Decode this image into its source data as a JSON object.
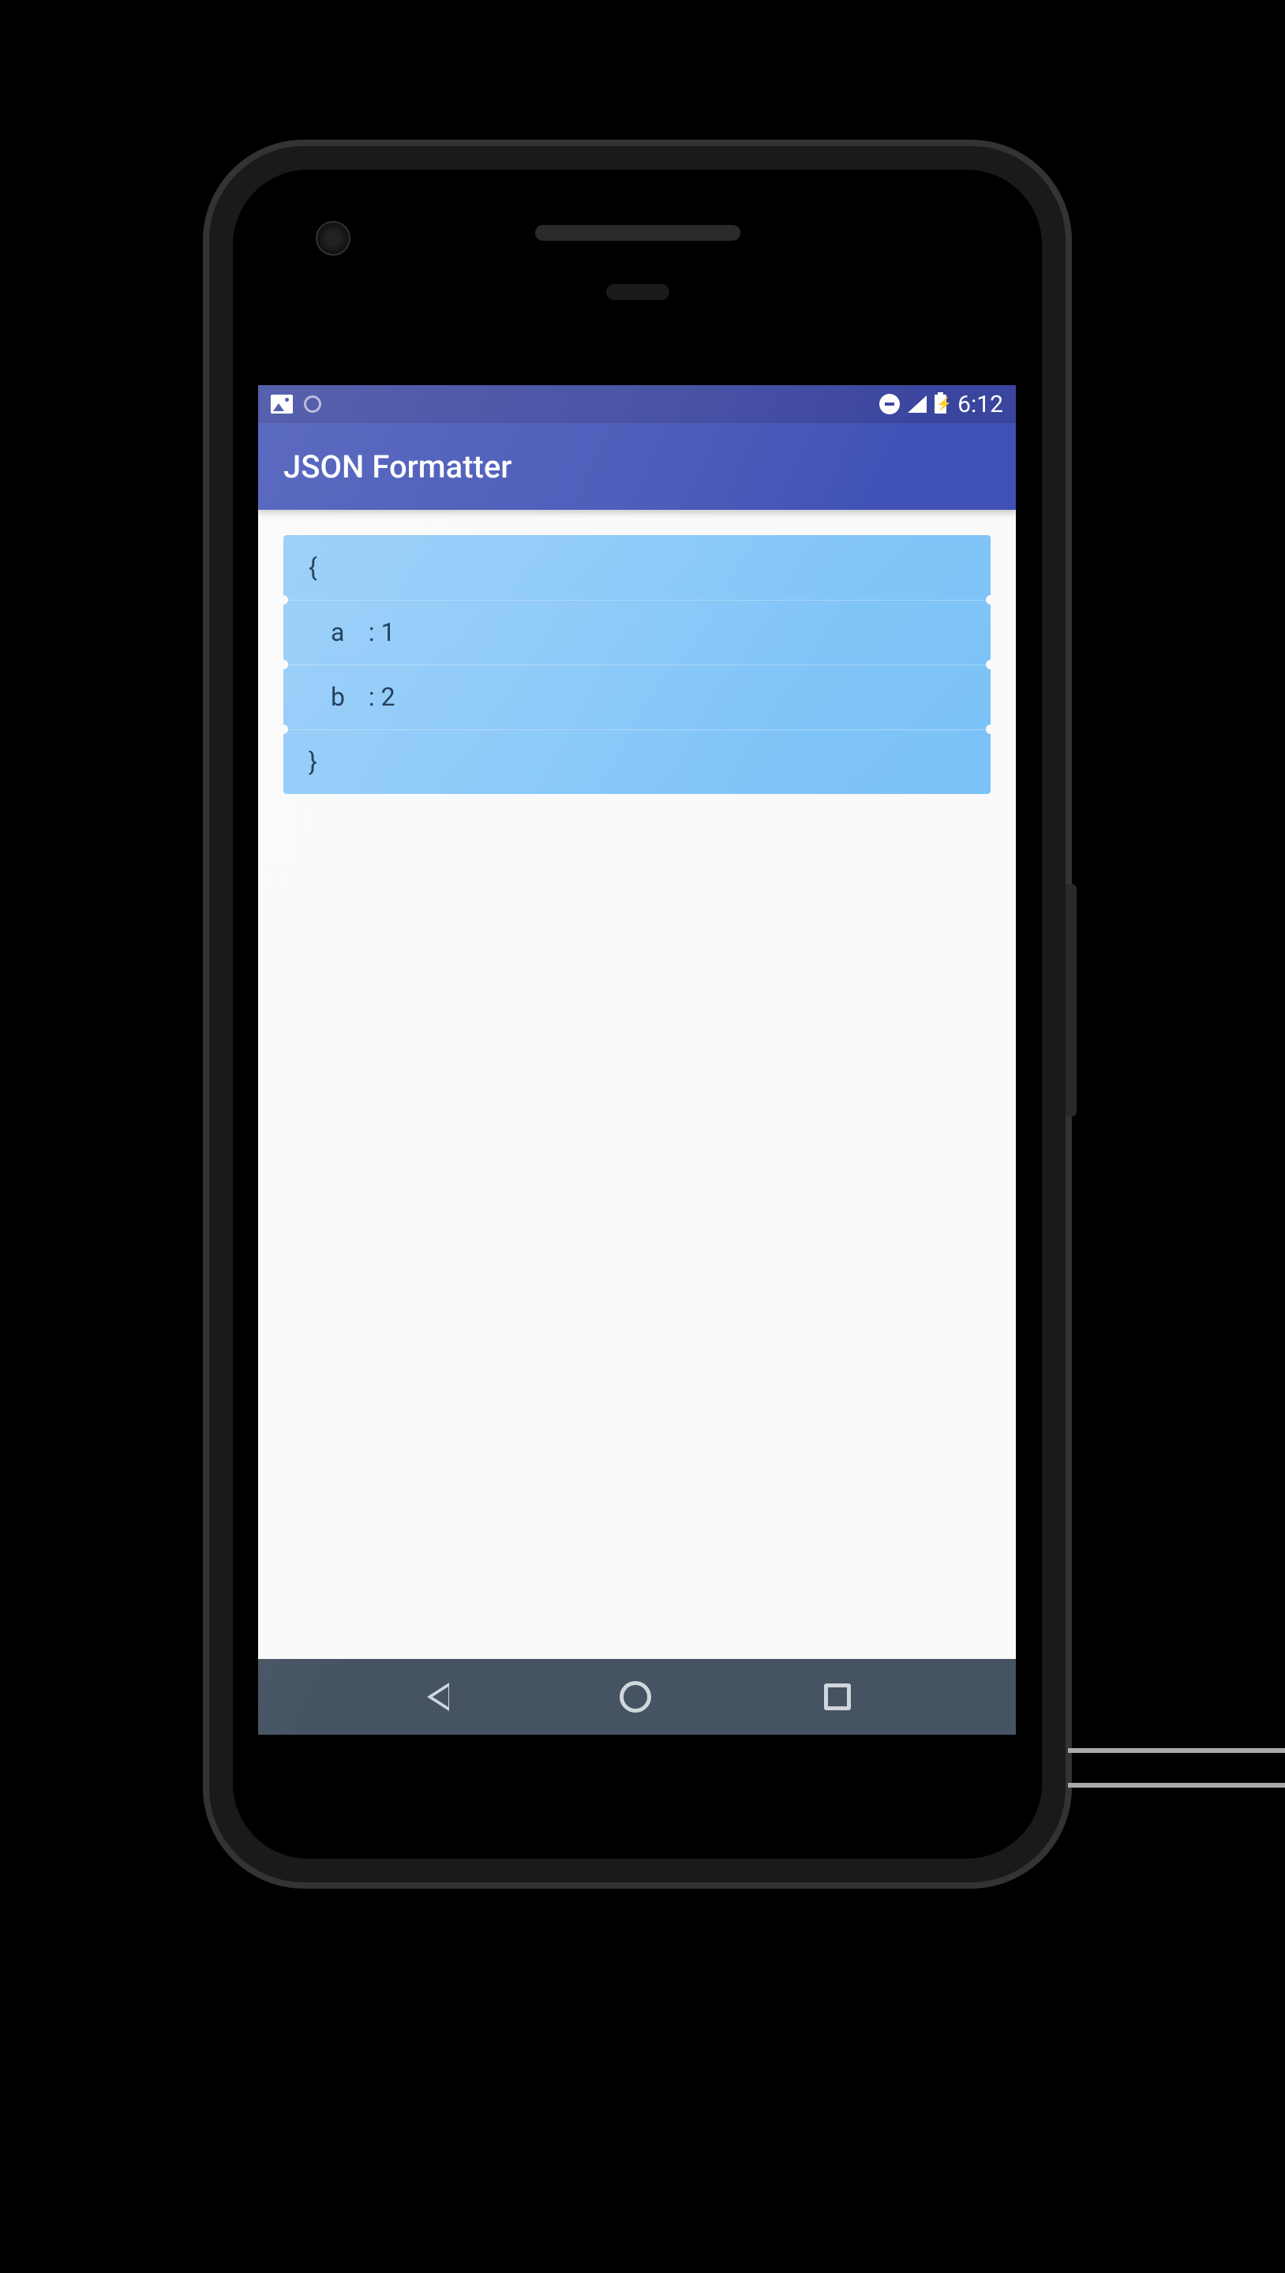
{
  "status_bar": {
    "time": "6:12"
  },
  "app_bar": {
    "title": "JSON Formatter"
  },
  "json_content": {
    "lines": [
      {
        "text": "{",
        "indent": 0,
        "key": "",
        "sep": "",
        "value": ""
      },
      {
        "text": "",
        "indent": 1,
        "key": "a",
        "sep": ":",
        "value": "1"
      },
      {
        "text": "",
        "indent": 1,
        "key": "b",
        "sep": ":",
        "value": "2"
      },
      {
        "text": "}",
        "indent": 0,
        "key": "",
        "sep": "",
        "value": ""
      }
    ]
  }
}
